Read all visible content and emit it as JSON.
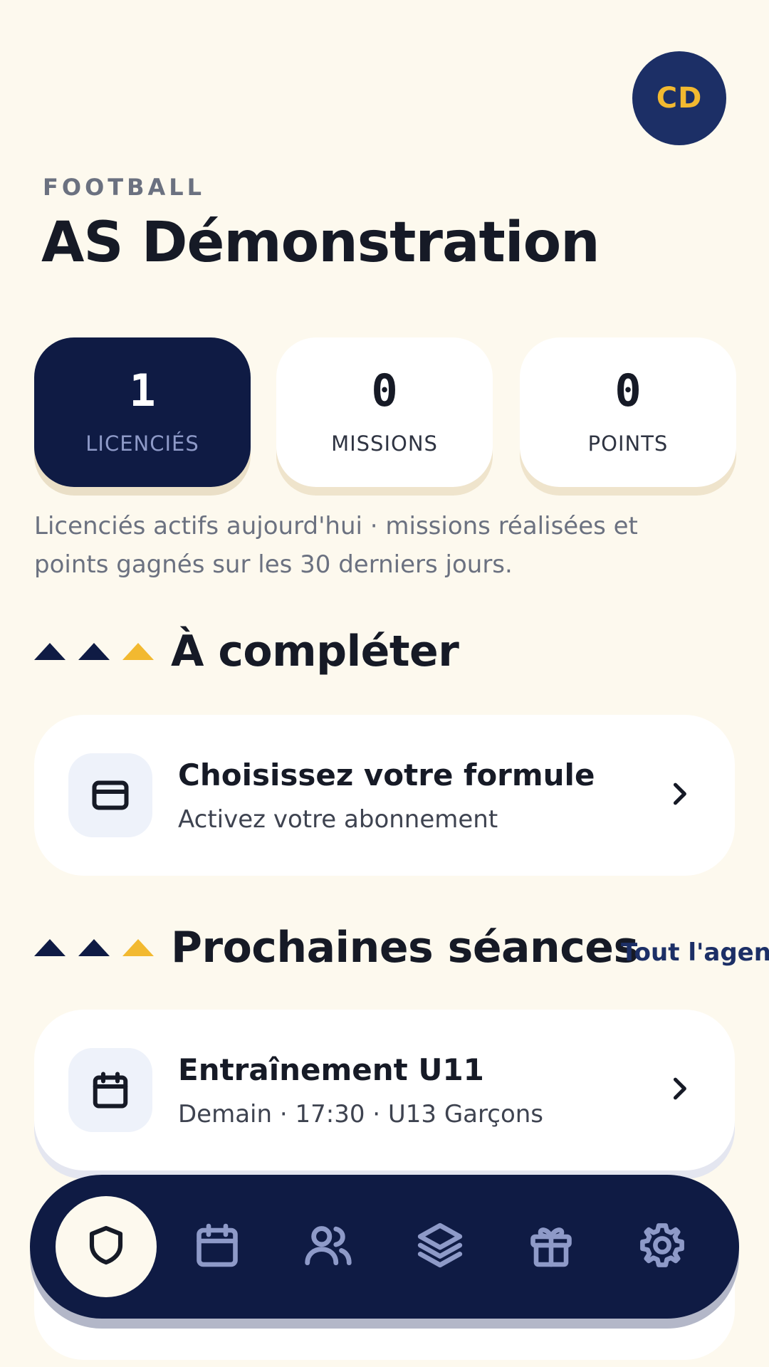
{
  "header": {
    "avatar_initials": "CD",
    "sport": "FOOTBALL",
    "club_name": "AS Démonstration"
  },
  "stats": [
    {
      "value": "1",
      "label": "LICENCIÉS"
    },
    {
      "value": "0",
      "label": "MISSIONS"
    },
    {
      "value": "0",
      "label": "POINTS"
    }
  ],
  "stats_note": "Licenciés actifs aujourd'hui · missions réalisées et points gagnés sur les 30 derniers jours.",
  "todo": {
    "title": "À compléter",
    "items": [
      {
        "title": "Choisissez votre formule",
        "subtitle": "Activez votre abonnement",
        "icon": "credit-card-icon"
      }
    ]
  },
  "sessions": {
    "title": "Prochaines séances",
    "see_all": "Tout l'agenda",
    "items": [
      {
        "title": "Entraînement U11",
        "subtitle": "Demain · 17:30 · U13 Garçons",
        "icon": "calendar-icon"
      }
    ]
  },
  "nav": {
    "items": [
      {
        "name": "club",
        "icon": "shield-icon",
        "active": true
      },
      {
        "name": "agenda",
        "icon": "calendar-icon",
        "active": false
      },
      {
        "name": "members",
        "icon": "users-icon",
        "active": false
      },
      {
        "name": "missions",
        "icon": "layers-icon",
        "active": false
      },
      {
        "name": "rewards",
        "icon": "gift-icon",
        "active": false
      },
      {
        "name": "settings",
        "icon": "gear-icon",
        "active": false
      }
    ]
  },
  "colors": {
    "background": "#fdf9ee",
    "navy": "#0f1b44",
    "gold": "#f2b930",
    "text": "#161a26",
    "muted": "#6b7180",
    "nav_icon": "#8e9ac8"
  }
}
